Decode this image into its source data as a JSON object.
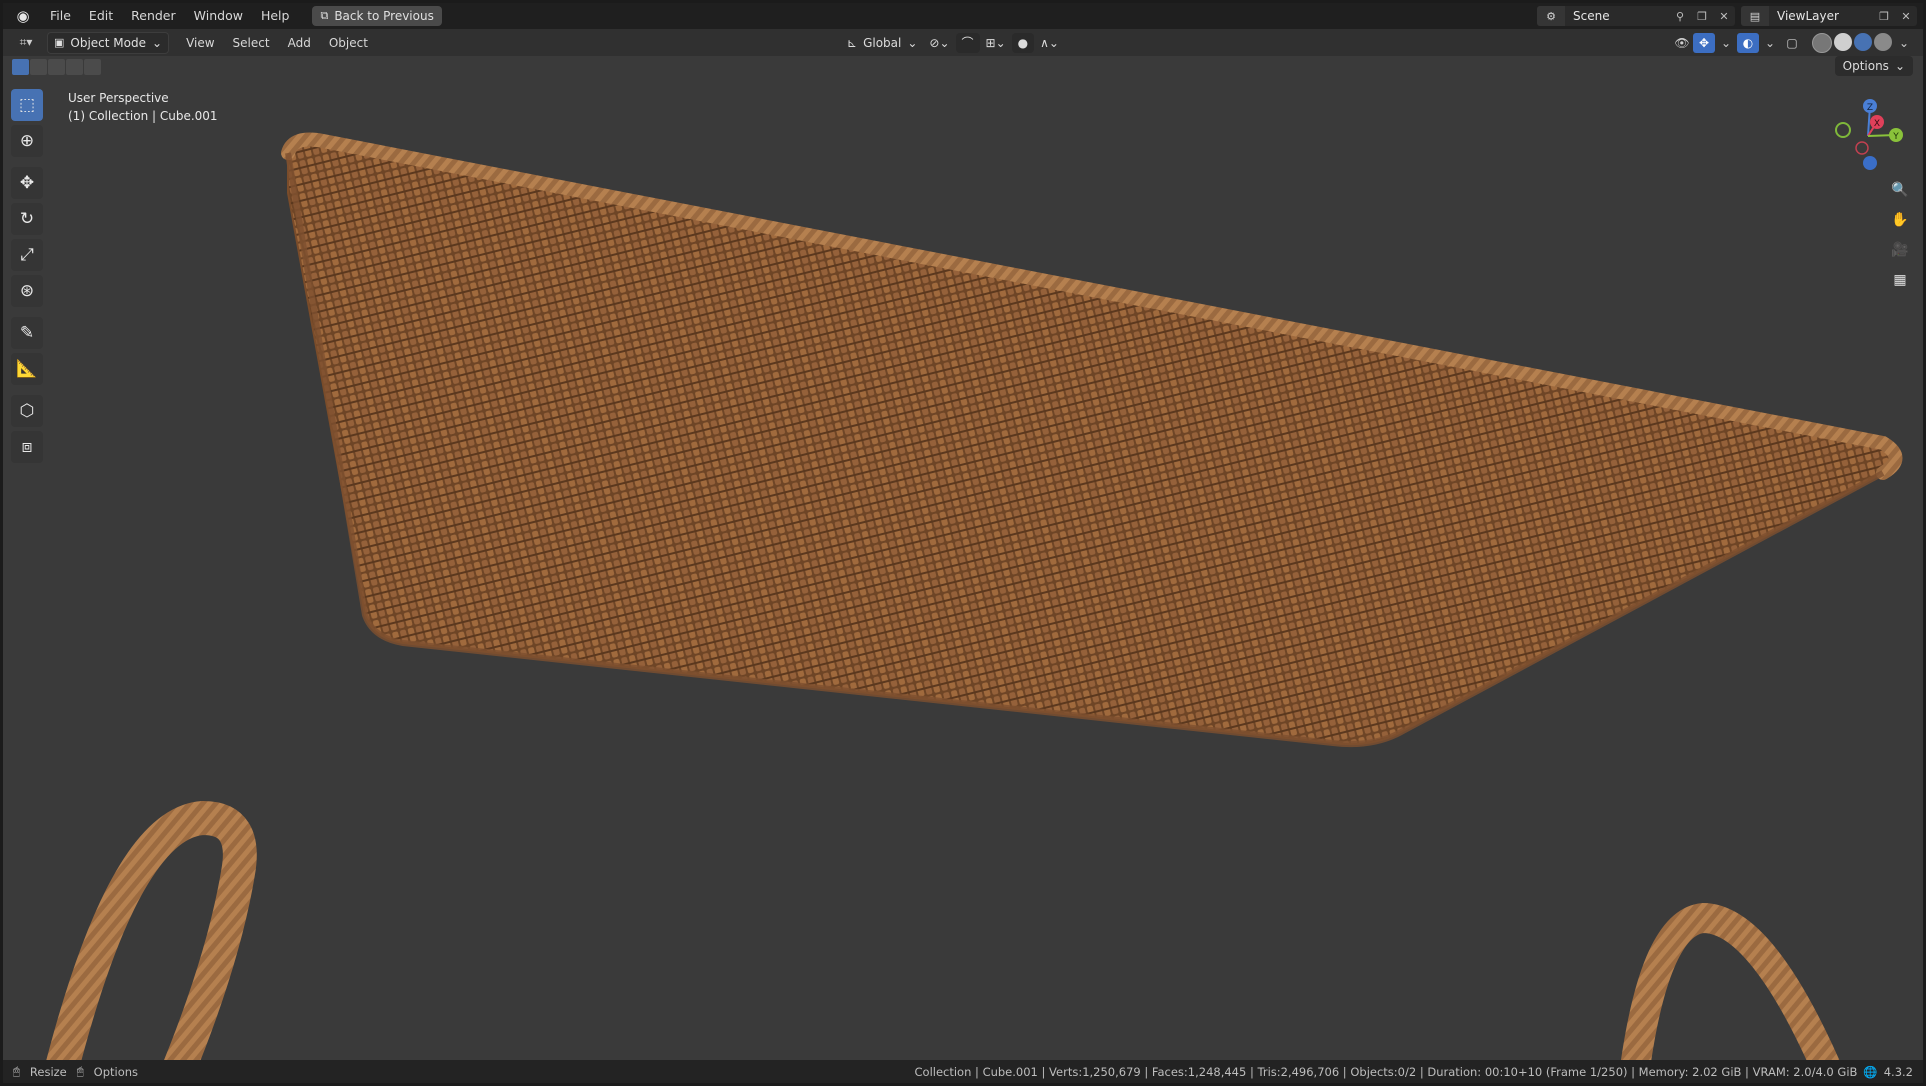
{
  "topbar": {
    "menu": [
      "File",
      "Edit",
      "Render",
      "Window",
      "Help"
    ],
    "back_button": "Back to Previous",
    "scene_name": "Scene",
    "view_layer": "ViewLayer"
  },
  "viewport_header": {
    "mode": "Object Mode",
    "menus": [
      "View",
      "Select",
      "Add",
      "Object"
    ],
    "transform_orientation": "Global",
    "options": "Options"
  },
  "viewport": {
    "perspective": "User Perspective",
    "collection_info": "(1) Collection | Cube.001",
    "gizmo_axes": [
      "Z",
      "X",
      "Y"
    ]
  },
  "toolbar": {
    "tools": [
      "select-box-icon",
      "cursor-icon",
      "move-icon",
      "rotate-icon",
      "scale-icon",
      "transform-icon",
      "annotate-icon",
      "measure-icon",
      "add-cube-icon",
      "extrude-icon"
    ]
  },
  "statusbar": {
    "left": [
      "Resize",
      "Options"
    ],
    "stats": "Collection | Cube.001 | Verts:1,250,679 | Faces:1,248,445 | Tris:2,496,706 | Objects:0/2 | Duration: 00:10+10 (Frame 1/250) | Memory: 2.02 GiB | VRAM: 2.0/4.0 GiB",
    "version": "4.3.2"
  },
  "colors": {
    "wicker": "#8a5a34",
    "viewport_bg": "#3a3a3a",
    "accent": "#4772b3"
  }
}
